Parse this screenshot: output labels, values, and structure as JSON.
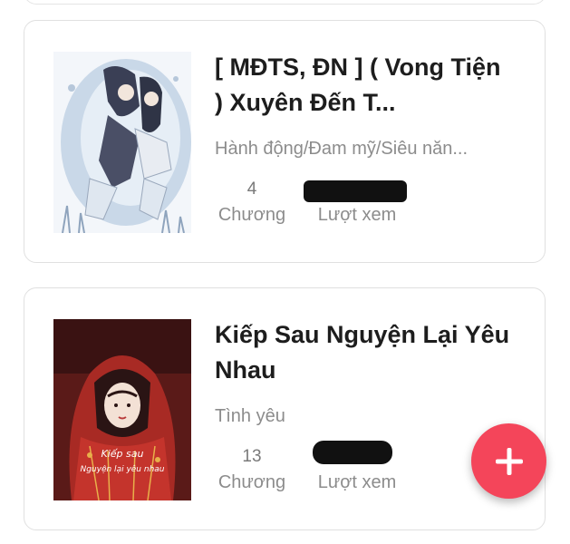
{
  "stories": [
    {
      "title": "[ MĐTS, ĐN ] ( Vong Tiện ) Xuyên Đến T...",
      "genres": "Hành động/Đam mỹ/Siêu năn...",
      "chapters": "4",
      "chapters_label": "Chương",
      "views_label": "Lượt xem"
    },
    {
      "title": "Kiếp Sau Nguyện Lại Yêu Nhau",
      "genres": "Tình yêu",
      "chapters": "13",
      "chapters_label": "Chương",
      "views_label": "Lượt xem",
      "cover_text": [
        "Kiếp sau",
        "Nguyện lại yêu nhau"
      ]
    }
  ],
  "fab": {
    "icon": "plus-icon",
    "color": "#f4455a"
  }
}
